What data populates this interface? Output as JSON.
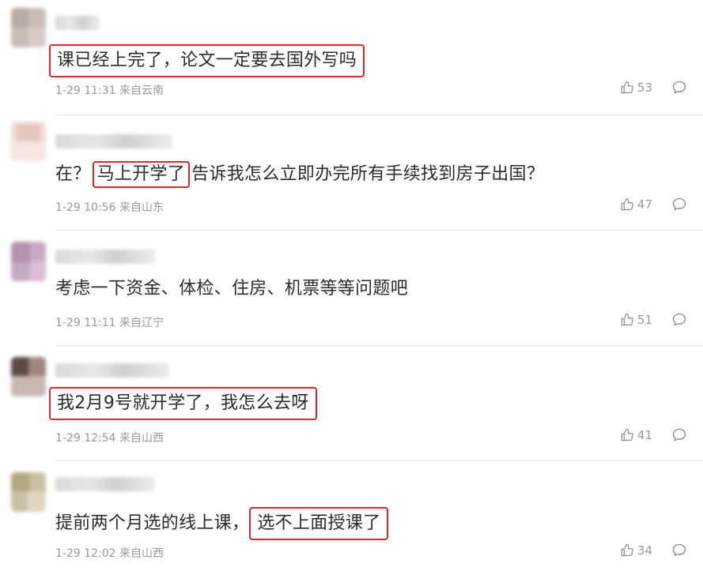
{
  "comments": [
    {
      "segments": [
        {
          "text": "课已经上完了，论文一定要去国外写吗",
          "highlight": true
        }
      ],
      "time": "1-29 11:31",
      "location": "来自云南",
      "likes": "53"
    },
    {
      "segments": [
        {
          "text": "在？",
          "highlight": false
        },
        {
          "text": "马上开学了",
          "highlight": true
        },
        {
          "text": "告诉我怎么立即办完所有手续找到房子出国？",
          "highlight": false
        }
      ],
      "time": "1-29 10:56",
      "location": "来自山东",
      "likes": "47"
    },
    {
      "segments": [
        {
          "text": "考虑一下资金、体检、住房、机票等等问题吧",
          "highlight": false
        }
      ],
      "time": "1-29 11:11",
      "location": "来自辽宁",
      "likes": "51"
    },
    {
      "segments": [
        {
          "text": "我2月9号就开学了，我怎么去呀",
          "highlight": true
        }
      ],
      "time": "1-29 12:54",
      "location": "来自山西",
      "likes": "41"
    },
    {
      "segments": [
        {
          "text": "提前两个月选的线上课，",
          "highlight": false
        },
        {
          "text": "选不上面授课了",
          "highlight": true
        }
      ],
      "time": "1-29 12:02",
      "location": "来自山西",
      "likes": "34"
    }
  ],
  "colors": {
    "highlight_border": "#e0262b",
    "meta_text": "#999999",
    "body_text": "#2b2b2b"
  },
  "icons": {
    "like": "thumbs-up-icon",
    "reply": "comment-bubble-icon"
  }
}
